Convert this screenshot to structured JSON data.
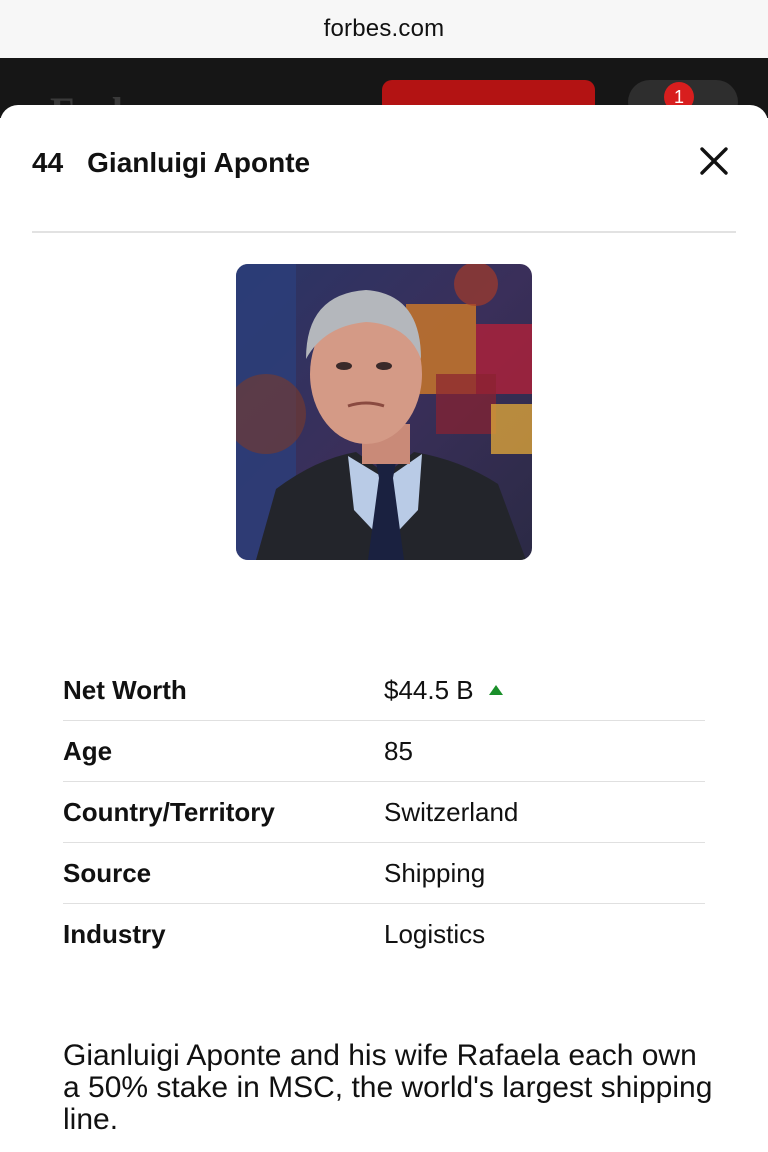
{
  "browser": {
    "url": "forbes.com"
  },
  "site_header": {
    "logo": "Forbes",
    "notification_count": "1"
  },
  "profile": {
    "rank": "44",
    "name": "Gianluigi Aponte",
    "portrait_alt": "Portrait of Gianluigi Aponte",
    "stats": [
      {
        "label": "Net Worth",
        "value": "$44.5 B",
        "trend": "up"
      },
      {
        "label": "Age",
        "value": "85"
      },
      {
        "label": "Country/Territory",
        "value": "Switzerland"
      },
      {
        "label": "Source",
        "value": "Shipping"
      },
      {
        "label": "Industry",
        "value": "Logistics"
      }
    ],
    "bio": "Gianluigi Aponte and his wife Rafaela each own a 50% stake in MSC, the world's largest shipping line."
  },
  "colors": {
    "trend_up": "#1a8f2a",
    "header_bg": "#161616",
    "cta_red": "#b31313"
  },
  "icons": {
    "close": "close-icon",
    "trend": "triangle-up-icon"
  }
}
